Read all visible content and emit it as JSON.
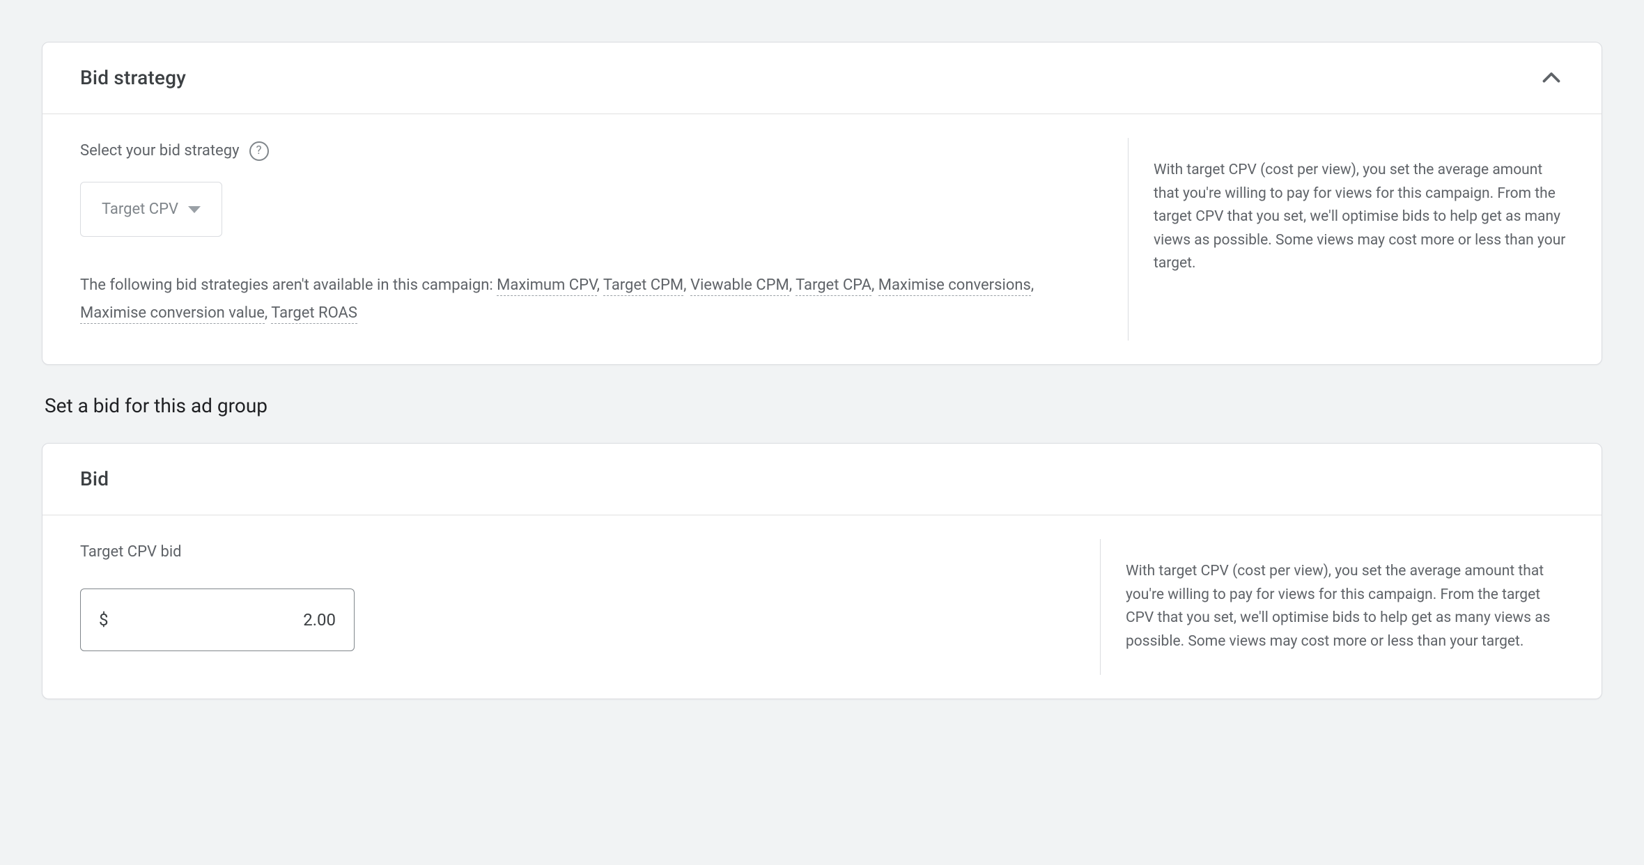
{
  "bid_strategy_card": {
    "title": "Bid strategy",
    "select_label": "Select your bid strategy",
    "selected_value": "Target CPV",
    "unavailable_prefix": "The following bid strategies aren't available in this campaign: ",
    "unavailable": [
      "Maximum CPV",
      "Target CPM",
      "Viewable CPM",
      "Target CPA",
      "Maximise conversions",
      "Maximise conversion value",
      "Target ROAS"
    ],
    "help_text": "With target CPV (cost per view), you set the average amount that you're willing to pay for views for this campaign. From the target CPV that you set, we'll optimise bids to help get as many views as possible. Some views may cost more or less than your target."
  },
  "section_heading": "Set a bid for this ad group",
  "bid_card": {
    "title": "Bid",
    "field_label": "Target CPV bid",
    "currency": "$",
    "value": "2.00",
    "help_text": "With target CPV (cost per view), you set the average amount that you're willing to pay for views for this campaign. From the target CPV that you set, we'll optimise bids to help get as many views as possible. Some views may cost more or less than your target."
  }
}
